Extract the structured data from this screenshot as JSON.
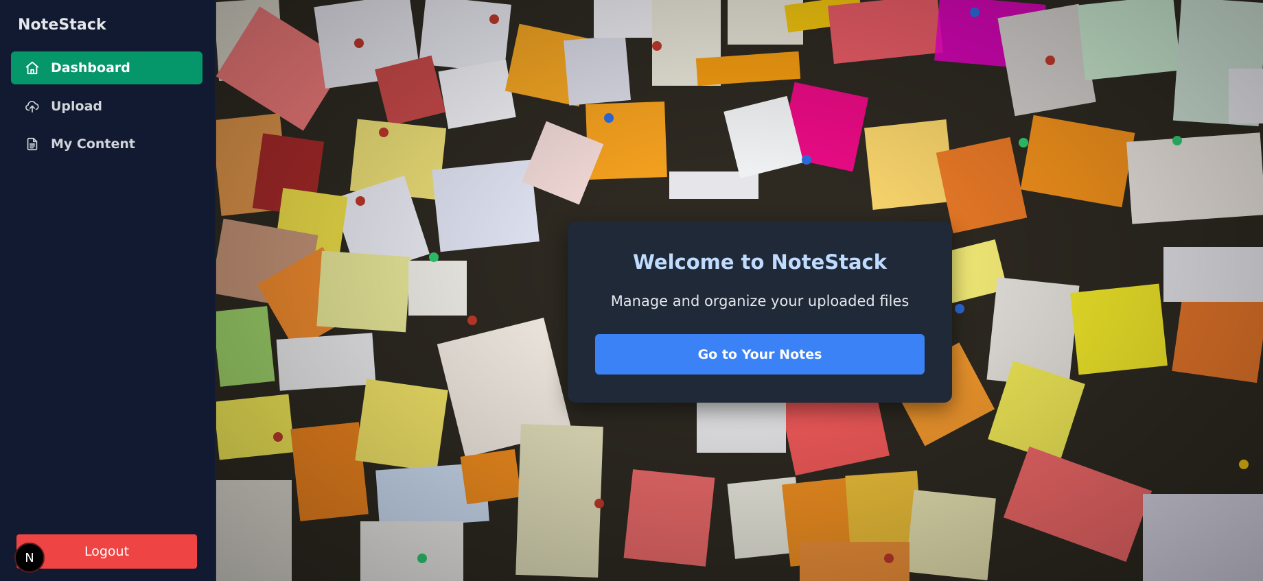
{
  "app": {
    "name": "NoteStack"
  },
  "sidebar": {
    "items": [
      {
        "label": "Dashboard",
        "icon": "home-icon",
        "active": true
      },
      {
        "label": "Upload",
        "icon": "cloud-upload-icon",
        "active": false
      },
      {
        "label": "My Content",
        "icon": "document-icon",
        "active": false
      }
    ],
    "logout_label": "Logout",
    "avatar_letter": "N"
  },
  "welcome": {
    "title": "Welcome to NoteStack",
    "subtitle": "Manage and organize your uploaded files",
    "cta_label": "Go to Your Notes"
  },
  "colors": {
    "sidebar_bg": "#111a30",
    "active_item": "#059669",
    "logout": "#ef4444",
    "card_bg": "#1f2937",
    "card_title": "#bfdbfe",
    "primary_button": "#3b82f6"
  },
  "background": {
    "description_icon": "sticky-notes-wall-image"
  }
}
